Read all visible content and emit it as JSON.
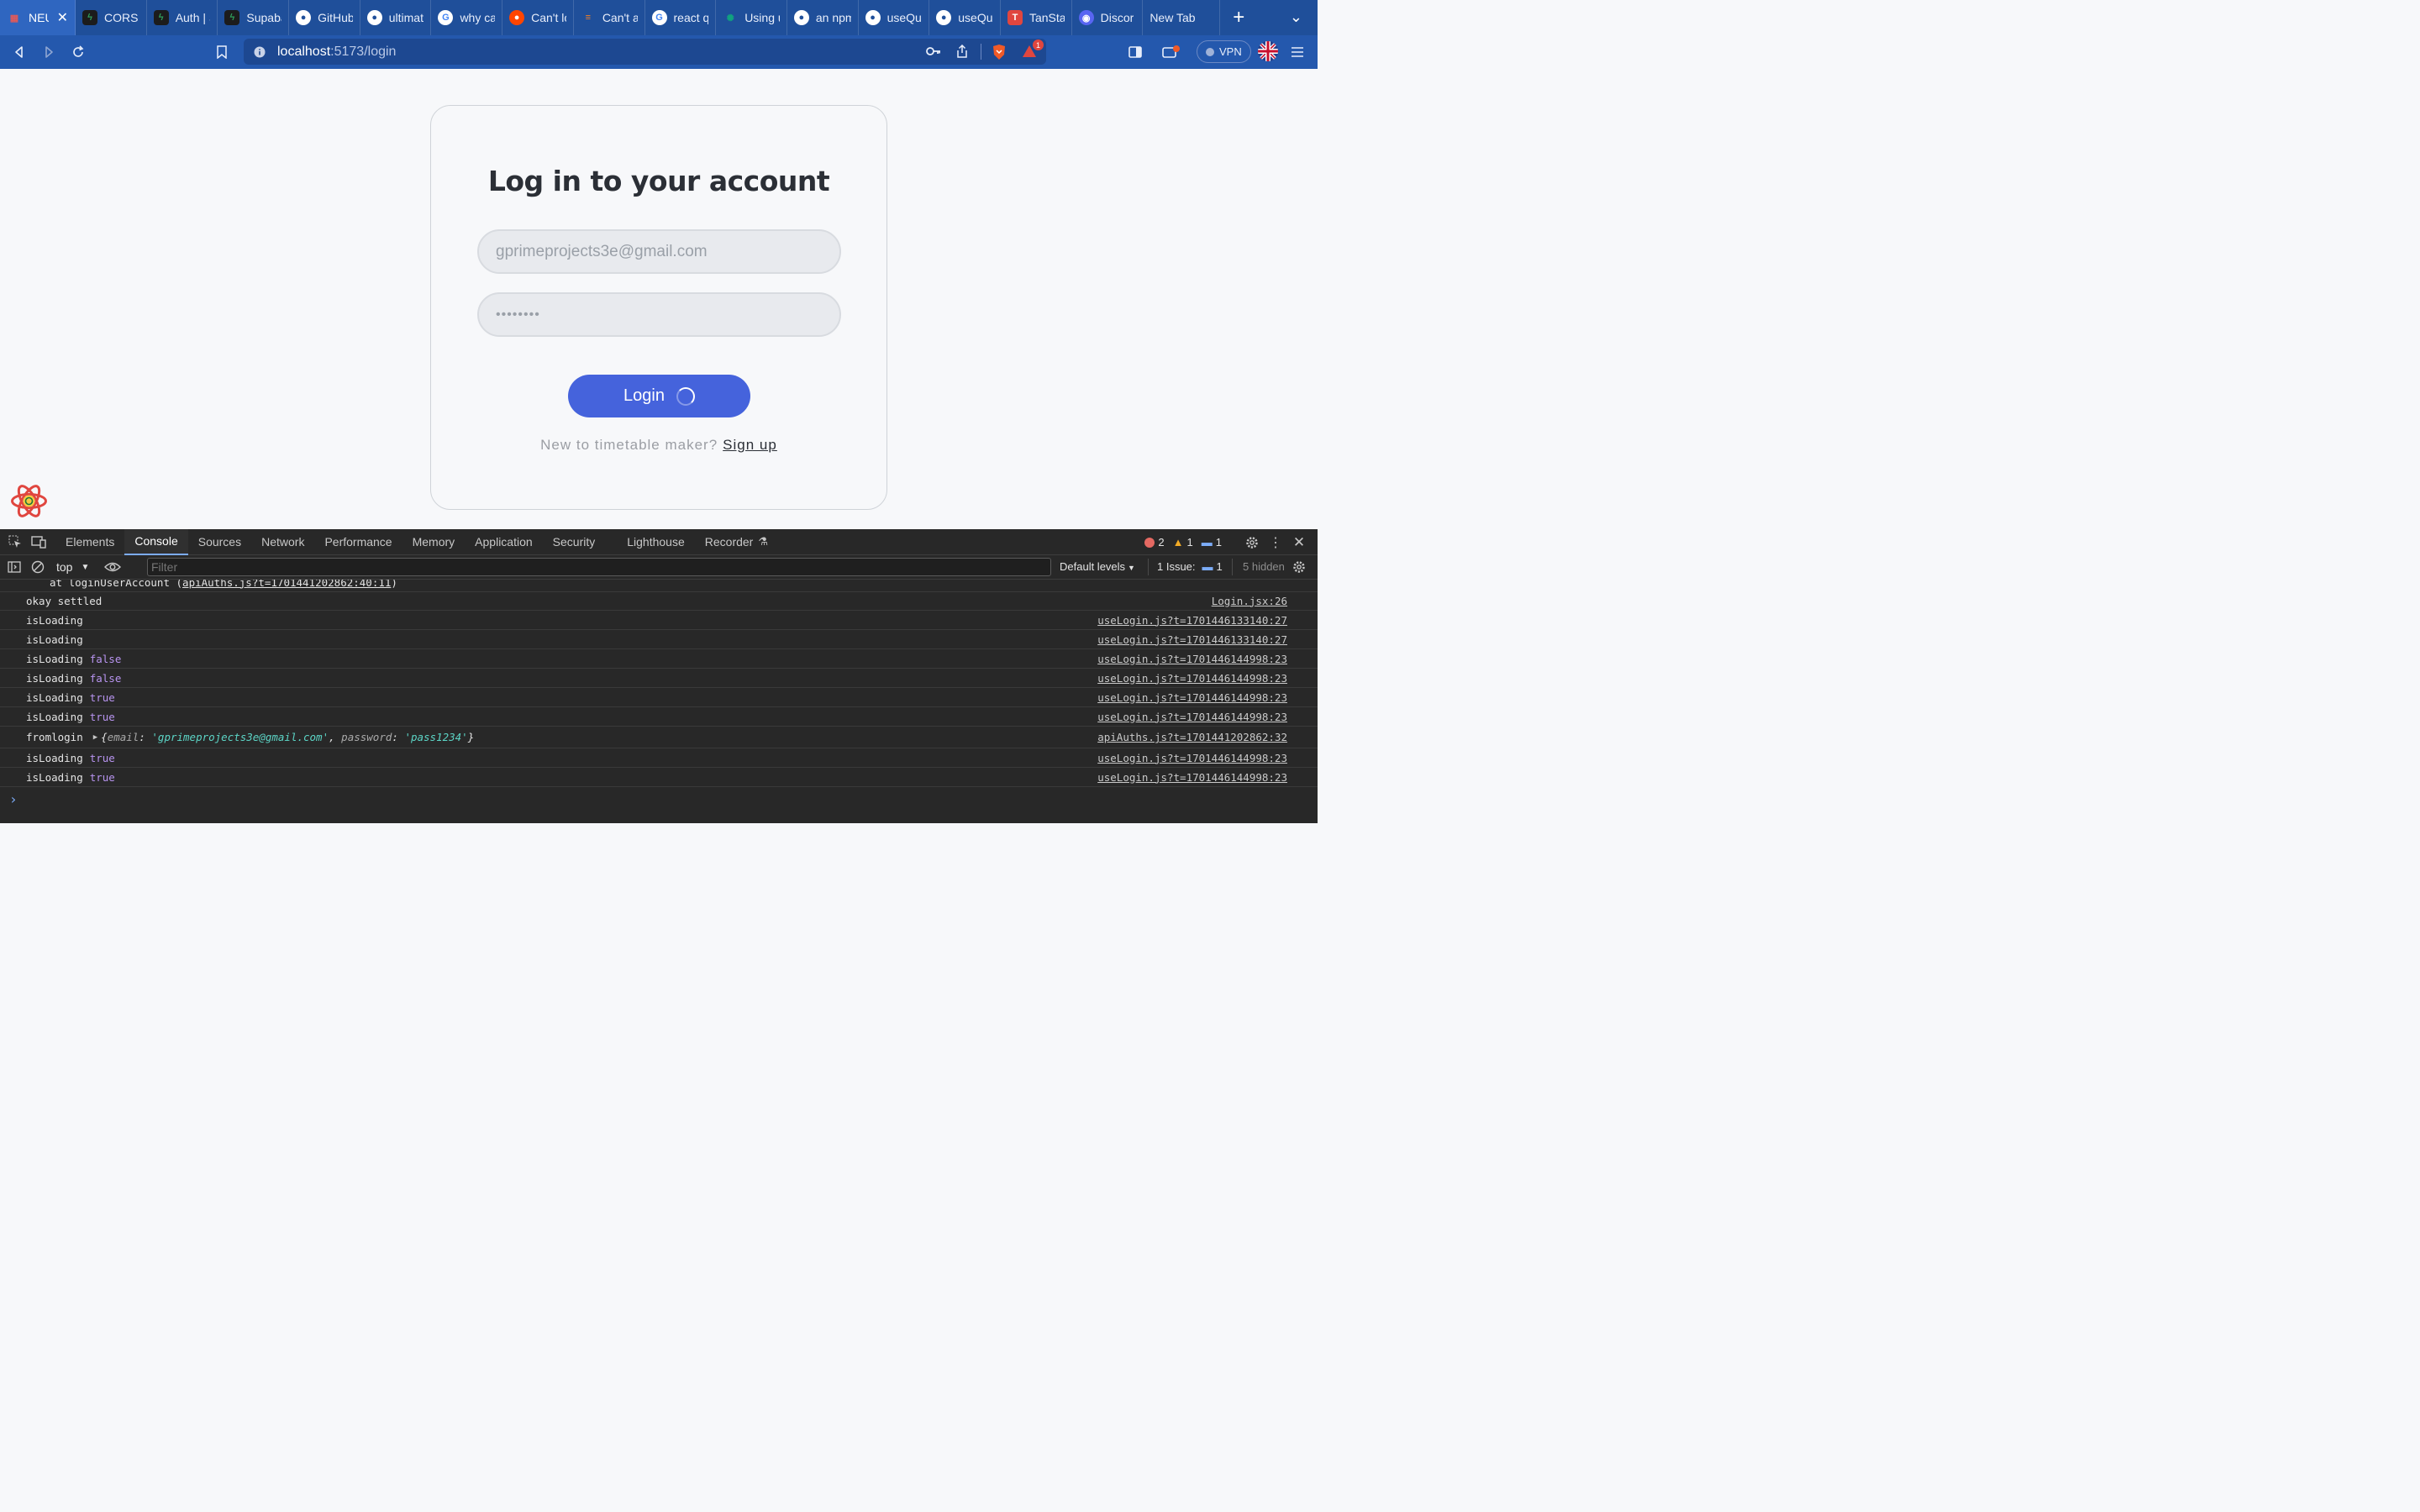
{
  "tabs": [
    {
      "title": "NEU",
      "icon": "calendar-icon",
      "color": "#e05a5a",
      "active": true
    },
    {
      "title": "CORS (",
      "icon": "supabase-icon",
      "color": "#2f9e5b"
    },
    {
      "title": "Auth | S",
      "icon": "supabase-icon",
      "color": "#2f9e5b"
    },
    {
      "title": "Supaba",
      "icon": "supabase-icon",
      "color": "#2f9e5b"
    },
    {
      "title": "GitHub",
      "icon": "github-icon",
      "color": "#ffffff"
    },
    {
      "title": "ultimat",
      "icon": "github-icon",
      "color": "#ffffff"
    },
    {
      "title": "why ca",
      "icon": "google-icon",
      "color": "#ffffff"
    },
    {
      "title": "Can't lo",
      "icon": "reddit-icon",
      "color": "#ff4500"
    },
    {
      "title": "Can't a",
      "icon": "stackoverflow-icon",
      "color": "#f48024"
    },
    {
      "title": "react q",
      "icon": "google-icon",
      "color": "#ffffff"
    },
    {
      "title": "Using u",
      "icon": "chatgpt-icon",
      "color": "#10a37f"
    },
    {
      "title": "an npm",
      "icon": "github-icon",
      "color": "#ffffff"
    },
    {
      "title": "useQue",
      "icon": "github-icon",
      "color": "#ffffff"
    },
    {
      "title": "useQue",
      "icon": "github-icon",
      "color": "#ffffff"
    },
    {
      "title": "TanSta",
      "icon": "tanstack-icon",
      "color": "#e0463f"
    },
    {
      "title": "Discor",
      "icon": "discord-icon",
      "color": "#5865f2"
    },
    {
      "title": "New Tab",
      "icon": "",
      "color": ""
    }
  ],
  "toolbar": {
    "url_host": "localhost",
    "url_path": ":5173/login",
    "brave_badge": "1",
    "vpn_label": "VPN"
  },
  "login": {
    "title": "Log in to your account",
    "email_value": "gprimeprojects3e@gmail.com",
    "password_value": "••••••••",
    "button_label": "Login",
    "signup_prompt": "New to timetable maker?",
    "signup_link": "Sign up"
  },
  "devtools": {
    "tabs": [
      "Elements",
      "Console",
      "Sources",
      "Network",
      "Performance",
      "Memory",
      "Application",
      "Security",
      "Lighthouse",
      "Recorder"
    ],
    "active_tab": "Console",
    "error_count": "2",
    "warning_count": "1",
    "info_count": "1",
    "context": "top",
    "filter_placeholder": "Filter",
    "levels": "Default levels",
    "issues_label": "1 Issue:",
    "issues_count": "1",
    "hidden_label": "5 hidden",
    "console_rows": [
      {
        "text": "at loginUserAccount (",
        "link": "apiAuths.js?t=1701441202862:40:11",
        "tail": ")",
        "src": ""
      },
      {
        "text": "okay settled",
        "src": "Login.jsx:26"
      },
      {
        "text": "isLoading",
        "kw": "",
        "src": "useLogin.js?t=1701446133140:27"
      },
      {
        "text": "isLoading",
        "kw": "",
        "src": "useLogin.js?t=1701446133140:27"
      },
      {
        "text": "isLoading",
        "kw": "false",
        "src": "useLogin.js?t=1701446144998:23"
      },
      {
        "text": "isLoading",
        "kw": "false",
        "src": "useLogin.js?t=1701446144998:23"
      },
      {
        "text": "isLoading",
        "kw": "true",
        "src": "useLogin.js?t=1701446144998:23"
      },
      {
        "text": "isLoading",
        "kw": "true",
        "src": "useLogin.js?t=1701446144998:23"
      },
      {
        "text": "fromlogin",
        "object": {
          "email": "'gprimeprojects3e@gmail.com'",
          "password": "'pass1234'"
        },
        "src": "apiAuths.js?t=1701441202862:32"
      },
      {
        "text": "isLoading",
        "kw": "true",
        "src": "useLogin.js?t=1701446144998:23"
      },
      {
        "text": "isLoading",
        "kw": "true",
        "src": "useLogin.js?t=1701446144998:23"
      }
    ],
    "prompt": "›"
  },
  "colors": {
    "tab_bar": "#1f4f9a",
    "toolbar": "#2458ad",
    "login_button": "#4563dc",
    "devtools_bg": "#282828",
    "keyword": "#b894f0",
    "string": "#5cd5c6"
  }
}
